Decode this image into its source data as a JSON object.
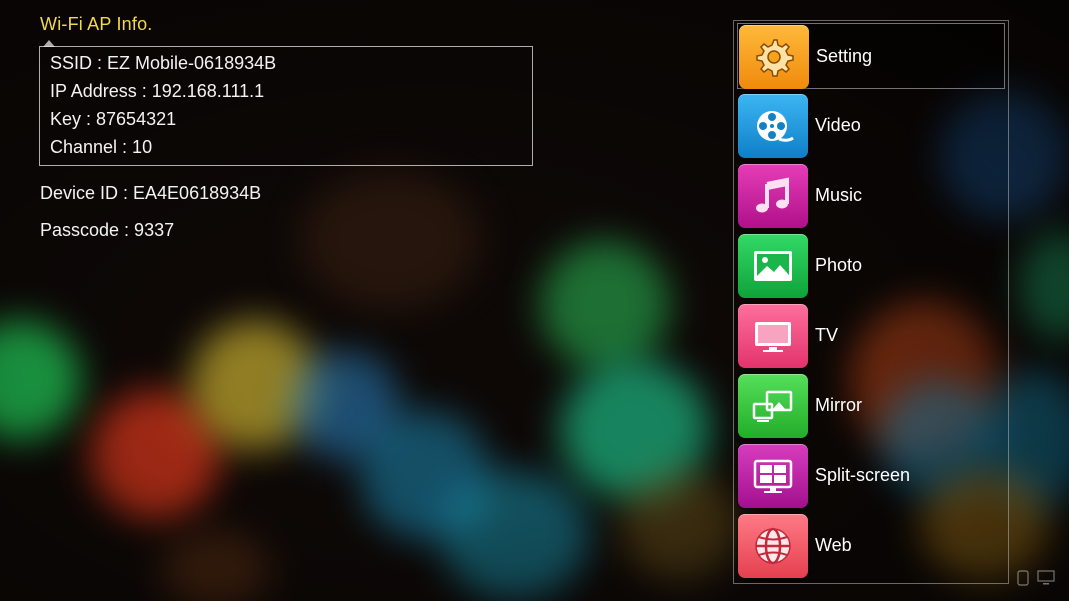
{
  "wifi": {
    "title": "Wi-Fi AP Info.",
    "ssid": "SSID : EZ Mobile-0618934B",
    "ip": "IP Address : 192.168.111.1",
    "key": "Key : 87654321",
    "channel": "Channel : 10"
  },
  "device": {
    "id": "Device ID : EA4E0618934B",
    "passcode": "Passcode : 9337"
  },
  "menu": {
    "items": [
      {
        "label": "Setting",
        "icon": "gear-icon",
        "color": "#f7a21b"
      },
      {
        "label": "Video",
        "icon": "film-reel-icon",
        "color": "#1e9be0"
      },
      {
        "label": "Music",
        "icon": "music-note-icon",
        "color": "#d21fa0"
      },
      {
        "label": "Photo",
        "icon": "picture-icon",
        "color": "#19c34a"
      },
      {
        "label": "TV",
        "icon": "tv-icon",
        "color": "#f24f83"
      },
      {
        "label": "Mirror",
        "icon": "screen-mirror-icon",
        "color": "#36c93c"
      },
      {
        "label": "Split-screen",
        "icon": "split-screen-icon",
        "color": "#c01aa8"
      },
      {
        "label": "Web",
        "icon": "globe-icon",
        "color": "#ef5b6a"
      }
    ]
  },
  "colors": {
    "title_yellow": "#f2d94a"
  }
}
